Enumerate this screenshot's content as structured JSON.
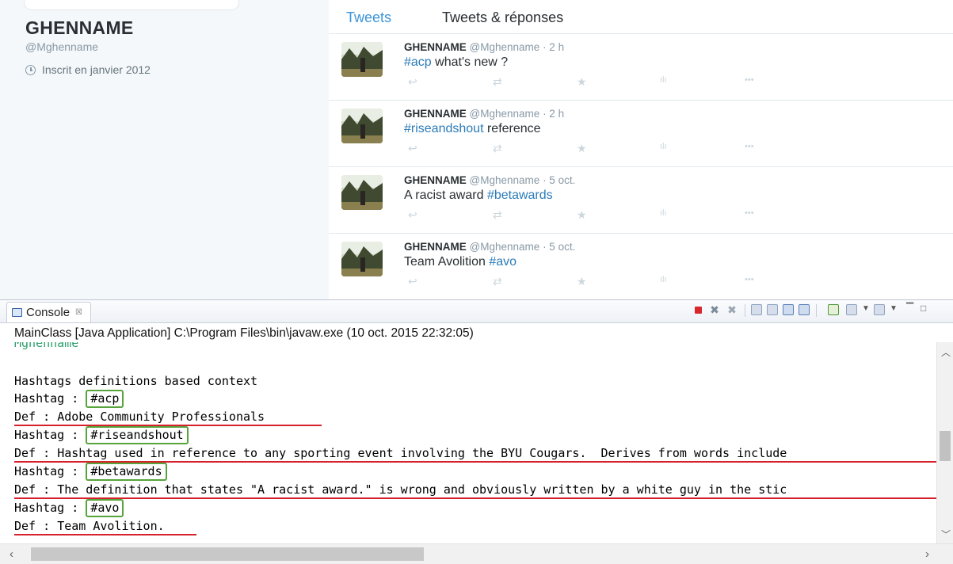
{
  "profile": {
    "name": "GHENNAME",
    "handle": "@Mghenname",
    "joined": "Inscrit en janvier 2012"
  },
  "tabs": {
    "active": "Tweets",
    "other": "Tweets & réponses"
  },
  "tweets": [
    {
      "name": "GHENNAME",
      "handle": "@Mghenname",
      "time": "· 2 h",
      "hashtag": "#acp",
      "text_before": "",
      "text_after": " what's new ?"
    },
    {
      "name": "GHENNAME",
      "handle": "@Mghenname",
      "time": "· 2 h",
      "hashtag": "#riseandshout",
      "text_before": "",
      "text_after": " reference"
    },
    {
      "name": "GHENNAME",
      "handle": "@Mghenname",
      "time": "· 5 oct.",
      "hashtag": "#betawards",
      "text_before": "A racist award ",
      "text_after": ""
    },
    {
      "name": "GHENNAME",
      "handle": "@Mghenname",
      "time": "· 5 oct.",
      "hashtag": "#avo",
      "text_before": "Team Avolition ",
      "text_after": ""
    }
  ],
  "tweet_actions": {
    "reply": "reply-icon",
    "retweet": "retweet-icon",
    "like": "star-icon",
    "stats": "analytics-icon",
    "more": "more-icon"
  },
  "console": {
    "tab_label": "Console",
    "launch": "MainClass [Java Application] C:\\Program Files\\bin\\javaw.exe (10 oct. 2015 22:32:05)",
    "user_line": "Mghenname",
    "heading": "Hashtags definitions based context",
    "hashtag_prefix": "Hashtag : ",
    "def_prefix": "Def : ",
    "entries": [
      {
        "tag": "#acp",
        "def": "Adobe Community Professionals"
      },
      {
        "tag": "#riseandshout",
        "def": "Hashtag used in reference to any sporting event involving the BYU Cougars.  Derives from words include"
      },
      {
        "tag": "#betawards",
        "def": "The definition that states \"A racist award.\" is wrong and obviously written by a white guy in the stic"
      },
      {
        "tag": "#avo",
        "def": "Team Avolition."
      }
    ]
  },
  "colors": {
    "twitter_blue": "#3b94d9",
    "hashtag": "#2b7bb9",
    "box": "#57a33c",
    "underline": "#d6202c",
    "user_line": "#2aa06a"
  }
}
